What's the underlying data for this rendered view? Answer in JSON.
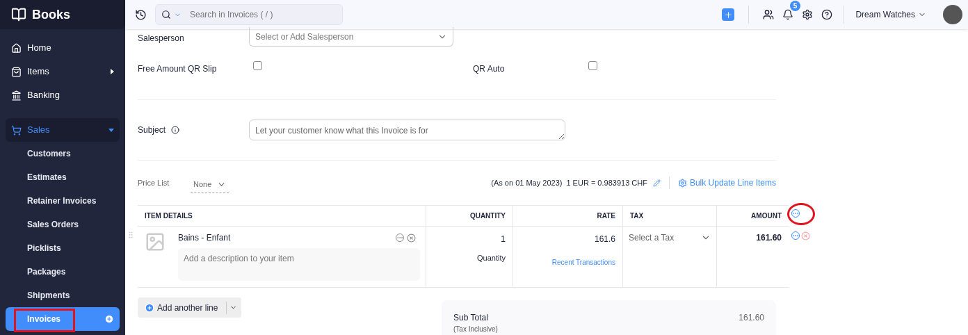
{
  "app": {
    "name": "Books"
  },
  "sidebar": {
    "items": [
      {
        "label": "Home",
        "kind": "link",
        "selected": false
      },
      {
        "label": "Items",
        "kind": "submenu",
        "selected": false
      },
      {
        "label": "Banking",
        "kind": "link",
        "selected": false
      },
      {
        "label": "Sales",
        "kind": "group",
        "selected": true,
        "expanded": true,
        "children": [
          {
            "label": "Customers",
            "selected": false
          },
          {
            "label": "Estimates",
            "selected": false
          },
          {
            "label": "Retainer Invoices",
            "selected": false
          },
          {
            "label": "Sales Orders",
            "selected": false
          },
          {
            "label": "Picklists",
            "selected": false
          },
          {
            "label": "Packages",
            "selected": false
          },
          {
            "label": "Shipments",
            "selected": false
          },
          {
            "label": "Invoices",
            "selected": true
          }
        ]
      }
    ]
  },
  "topbar": {
    "search": {
      "placeholder": "Search in Invoices ( / )"
    },
    "notifications": "5",
    "organization": "Dream Watches"
  },
  "form": {
    "salesperson": {
      "label": "Salesperson",
      "placeholder": "Select or Add Salesperson"
    },
    "checkboxes": [
      {
        "label": "Free Amount QR Slip",
        "checked": false
      },
      {
        "label": "QR Auto",
        "checked": false
      }
    ],
    "subject": {
      "label": "Subject",
      "placeholder": "Let your customer know what this Invoice is for"
    },
    "price_list": {
      "label": "Price List",
      "value": "None"
    },
    "exchange_rate": {
      "date": "(As on 01 May 2023)",
      "rate": "1 EUR = 0.983913 CHF"
    },
    "bulk_update": "Bulk Update Line Items"
  },
  "items_table": {
    "columns": [
      "ITEM DETAILS",
      "QUANTITY",
      "RATE",
      "TAX",
      "AMOUNT"
    ],
    "rows": [
      {
        "name": "Bains - Enfant",
        "description_placeholder": "Add a description to your item",
        "quantity": "1",
        "unit": "Quantity",
        "rate": "161.6",
        "rate_link": "Recent Transactions",
        "tax_placeholder": "Select a Tax",
        "amount": "161.60"
      }
    ]
  },
  "add_line": "Add another line",
  "totals": [
    {
      "label": "Sub Total",
      "note": "(Tax Inclusive)",
      "value": "161.60"
    }
  ]
}
